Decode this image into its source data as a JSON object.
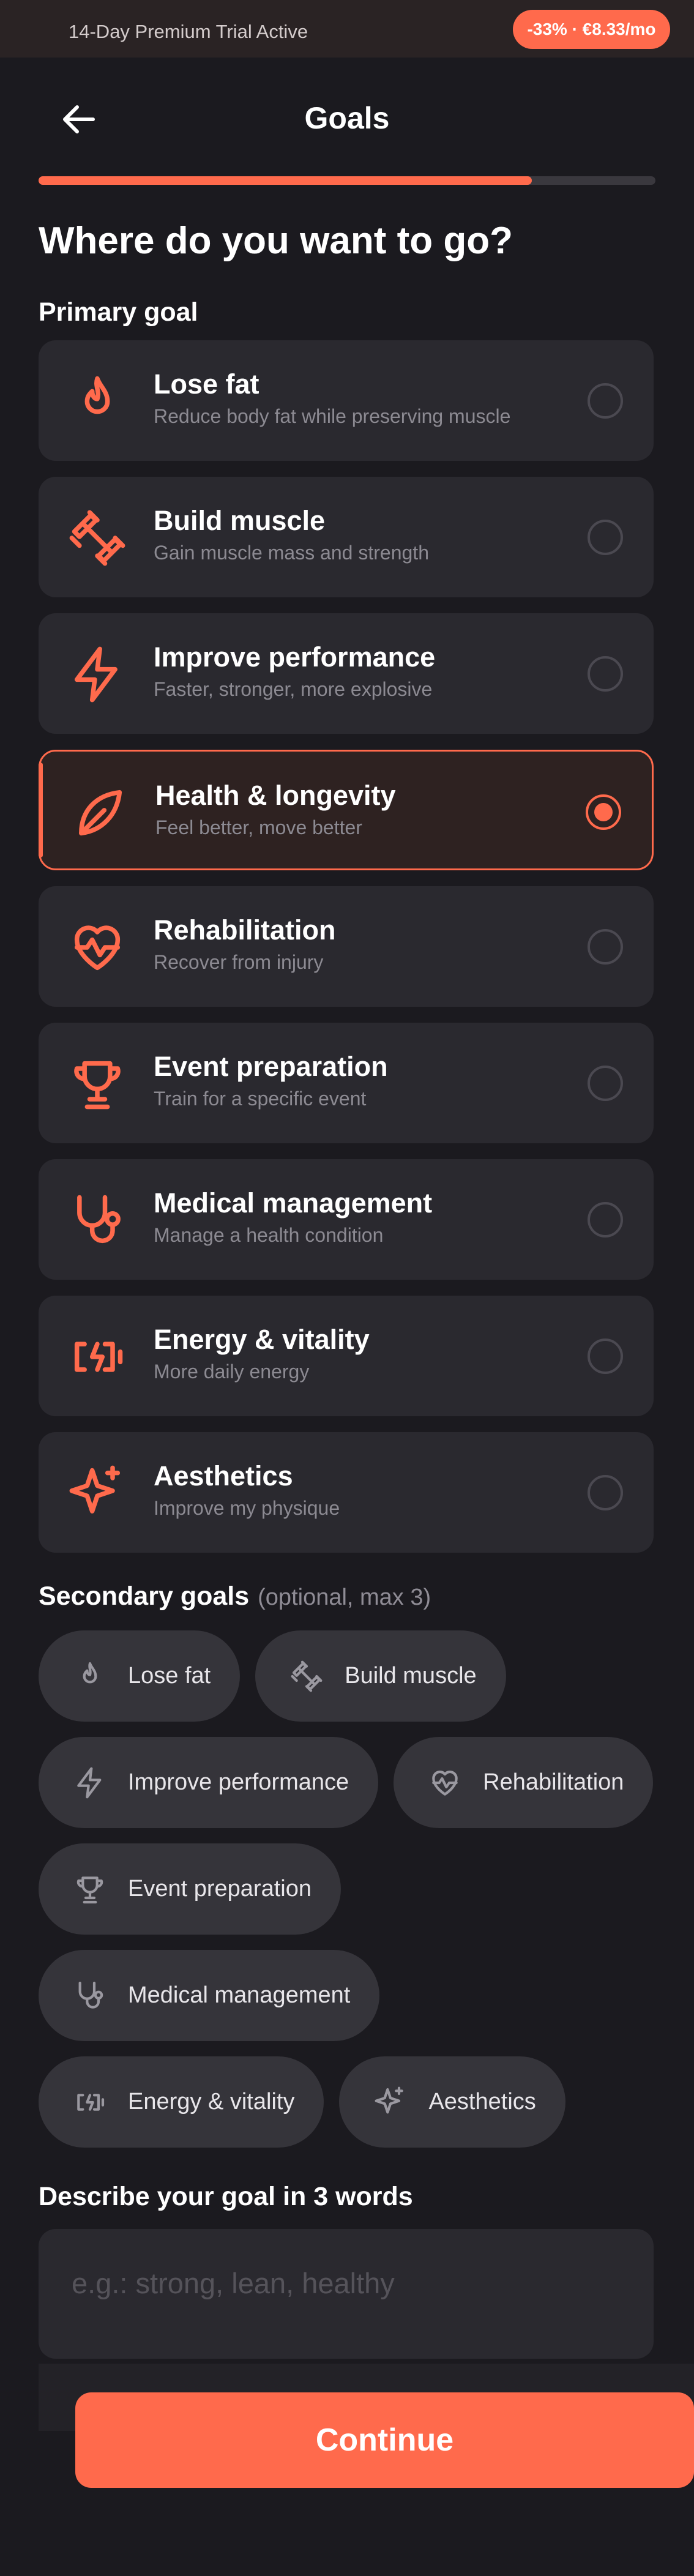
{
  "trial_banner": {
    "text": "14-Day Premium Trial Active",
    "promo": "-33% · €8.33/mo"
  },
  "header": {
    "title": "Goals",
    "back_icon": "arrow-left-icon"
  },
  "progress": {
    "fraction": 0.8
  },
  "heading": "Where do you want to go?",
  "primary": {
    "label": "Primary goal",
    "selected_index": 3,
    "options": [
      {
        "title": "Lose fat",
        "subtitle": "Reduce body fat while preserving muscle",
        "icon": "flame-icon"
      },
      {
        "title": "Build muscle",
        "subtitle": "Gain muscle mass and strength",
        "icon": "dumbbell-icon"
      },
      {
        "title": "Improve performance",
        "subtitle": "Faster, stronger, more explosive",
        "icon": "lightning-icon"
      },
      {
        "title": "Health & longevity",
        "subtitle": "Feel better, move better",
        "icon": "leaf-icon"
      },
      {
        "title": "Rehabilitation",
        "subtitle": "Recover from injury",
        "icon": "heart-pulse-icon"
      },
      {
        "title": "Event preparation",
        "subtitle": "Train for a specific event",
        "icon": "trophy-icon"
      },
      {
        "title": "Medical management",
        "subtitle": "Manage a health condition",
        "icon": "stethoscope-icon"
      },
      {
        "title": "Energy & vitality",
        "subtitle": "More daily energy",
        "icon": "battery-charging-icon"
      },
      {
        "title": "Aesthetics",
        "subtitle": "Improve my physique",
        "icon": "sparkles-icon"
      }
    ]
  },
  "secondary": {
    "label": "Secondary goals",
    "note": "(optional, max 3)",
    "chips": [
      {
        "label": "Lose fat",
        "icon": "flame-icon"
      },
      {
        "label": "Build muscle",
        "icon": "dumbbell-icon"
      },
      {
        "label": "Improve performance",
        "icon": "lightning-icon"
      },
      {
        "label": "Rehabilitation",
        "icon": "heart-pulse-icon"
      },
      {
        "label": "Event preparation",
        "icon": "trophy-icon"
      },
      {
        "label": "Medical management",
        "icon": "stethoscope-icon"
      },
      {
        "label": "Energy & vitality",
        "icon": "battery-charging-icon"
      },
      {
        "label": "Aesthetics",
        "icon": "sparkles-icon"
      }
    ]
  },
  "describe": {
    "label": "Describe your goal in 3 words",
    "placeholder": "e.g.: strong, lean, healthy",
    "value": ""
  },
  "continue_label": "Continue",
  "colors": {
    "accent": "#ff6a4c",
    "background": "#1b1a1f",
    "card": "#2a292f",
    "chip": "#35343a",
    "selected_card": "#2e2221"
  }
}
